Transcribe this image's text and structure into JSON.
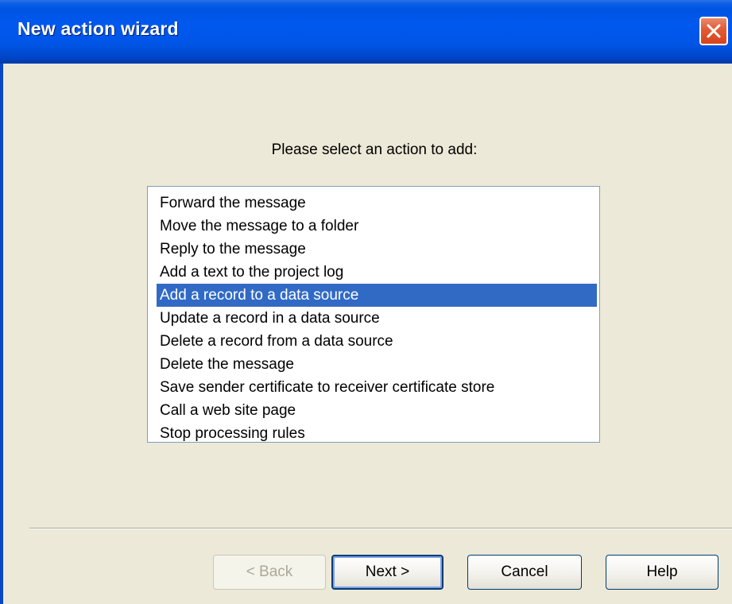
{
  "window": {
    "title": "New action wizard"
  },
  "prompt": "Please select an action to add:",
  "actions": [
    "Forward the message",
    "Move the message to a folder",
    "Reply to the message",
    "Add a text to the project log",
    "Add a record to a data source",
    "Update a record in a data source",
    "Delete a record from a data source",
    "Delete the message",
    "Save sender certificate to receiver certificate store",
    "Call a web site page",
    "Stop processing rules"
  ],
  "selected_action": "Add a record to a data source",
  "buttons": {
    "back": "< Back",
    "next": "Next >",
    "cancel": "Cancel",
    "help": "Help"
  },
  "icons": {
    "close": "close-icon"
  },
  "colors": {
    "titlebar": "#0054e3",
    "selection": "#316ac5",
    "close_button": "#e35d37",
    "dialog_background": "#ece9d8"
  }
}
